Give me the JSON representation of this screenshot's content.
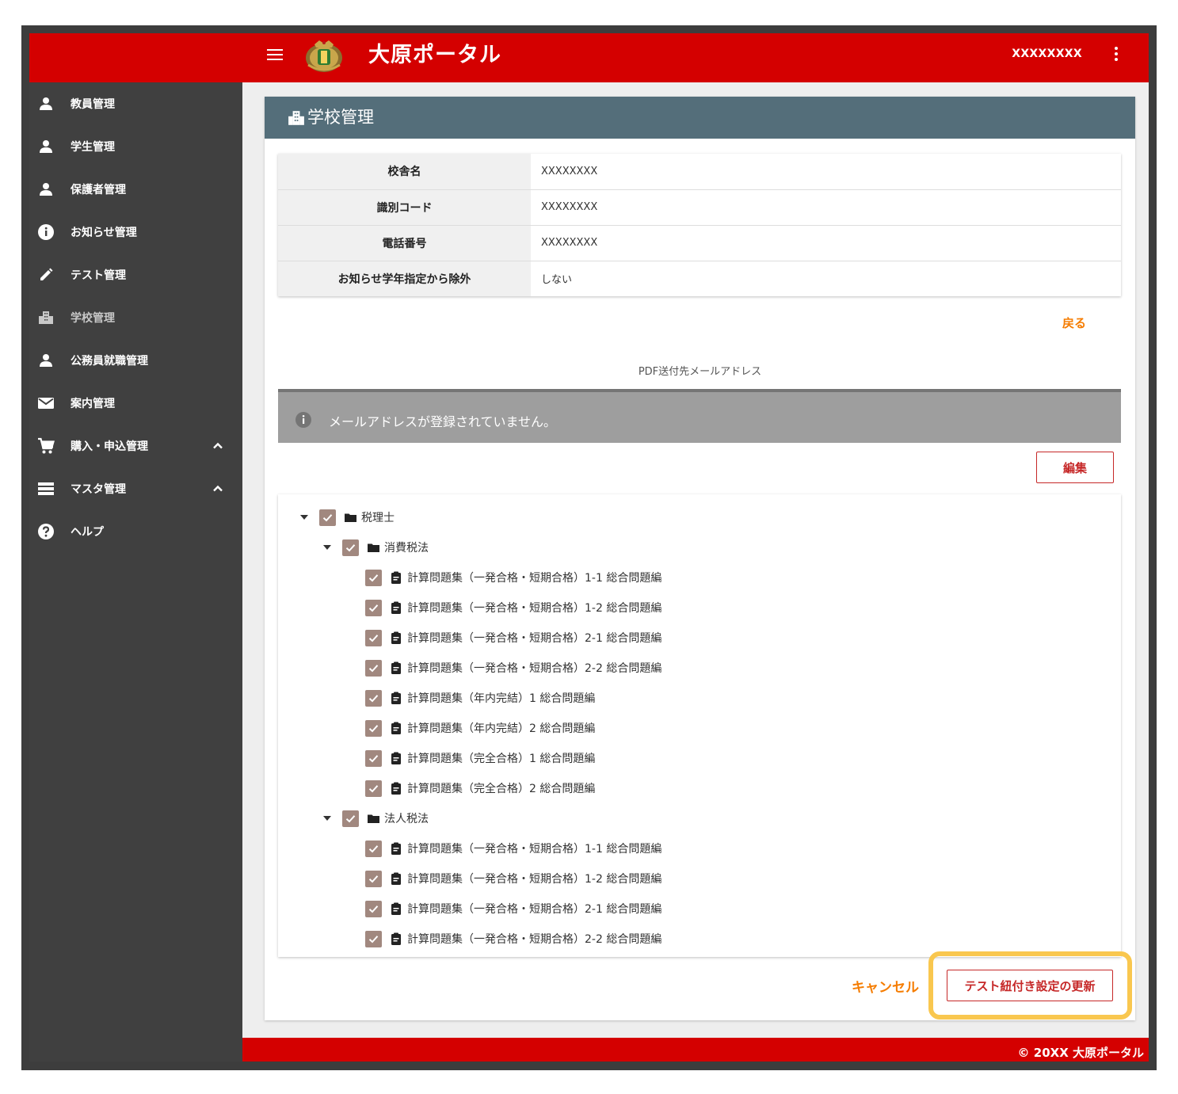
{
  "header": {
    "app_title": "大原ポータル",
    "user_name": "XXXXXXXX"
  },
  "sidebar": {
    "items": [
      {
        "label": "教員管理",
        "icon": "person-icon"
      },
      {
        "label": "学生管理",
        "icon": "person-icon"
      },
      {
        "label": "保護者管理",
        "icon": "person-icon"
      },
      {
        "label": "お知らせ管理",
        "icon": "info-icon"
      },
      {
        "label": "テスト管理",
        "icon": "pencil-icon"
      },
      {
        "label": "学校管理",
        "icon": "building-icon",
        "active": true
      },
      {
        "label": "公務員就職管理",
        "icon": "person-icon"
      },
      {
        "label": "案内管理",
        "icon": "mail-icon"
      },
      {
        "label": "購入・申込管理",
        "icon": "cart-icon",
        "expandable": true
      },
      {
        "label": "マスタ管理",
        "icon": "list-icon",
        "expandable": true
      },
      {
        "label": "ヘルプ",
        "icon": "help-icon"
      }
    ]
  },
  "page": {
    "title": "学校管理",
    "info_rows": [
      {
        "label": "校舎名",
        "value": "XXXXXXXX"
      },
      {
        "label": "識別コード",
        "value": "XXXXXXXX"
      },
      {
        "label": "電話番号",
        "value": "XXXXXXXX"
      },
      {
        "label": "お知らせ学年指定から除外",
        "value": "しない"
      }
    ],
    "back_label": "戻る",
    "pdf_section_label": "PDF送付先メールアドレス",
    "alert_text": "メールアドレスが登録されていません。",
    "edit_label": "編集",
    "cancel_label": "キャンセル",
    "update_label": "テスト紐付き設定の更新"
  },
  "tree": {
    "root": {
      "label": "税理士",
      "checked": true,
      "expanded": true
    },
    "groups": [
      {
        "label": "消費税法",
        "checked": true,
        "expanded": true,
        "items": [
          "計算問題集（一発合格・短期合格）1-1 総合問題編",
          "計算問題集（一発合格・短期合格）1-2 総合問題編",
          "計算問題集（一発合格・短期合格）2-1 総合問題編",
          "計算問題集（一発合格・短期合格）2-2 総合問題編",
          "計算問題集（年内完結）1 総合問題編",
          "計算問題集（年内完結）2 総合問題編",
          "計算問題集（完全合格）1 総合問題編",
          "計算問題集（完全合格）2 総合問題編"
        ]
      },
      {
        "label": "法人税法",
        "checked": true,
        "expanded": true,
        "items": [
          "計算問題集（一発合格・短期合格）1-1 総合問題編",
          "計算問題集（一発合格・短期合格）1-2 総合問題編",
          "計算問題集（一発合格・短期合格）2-1 総合問題編",
          "計算問題集（一発合格・短期合格）2-2 総合問題編"
        ]
      }
    ]
  },
  "footer": {
    "text": "© 20XX 大原ポータル"
  },
  "colors": {
    "brand_red": "#d40000",
    "sidebar_bg": "#404040",
    "card_header": "#546e7a",
    "accent_orange": "#f57c00",
    "checkbox": "#a1887f",
    "highlight": "#f9c74f"
  }
}
